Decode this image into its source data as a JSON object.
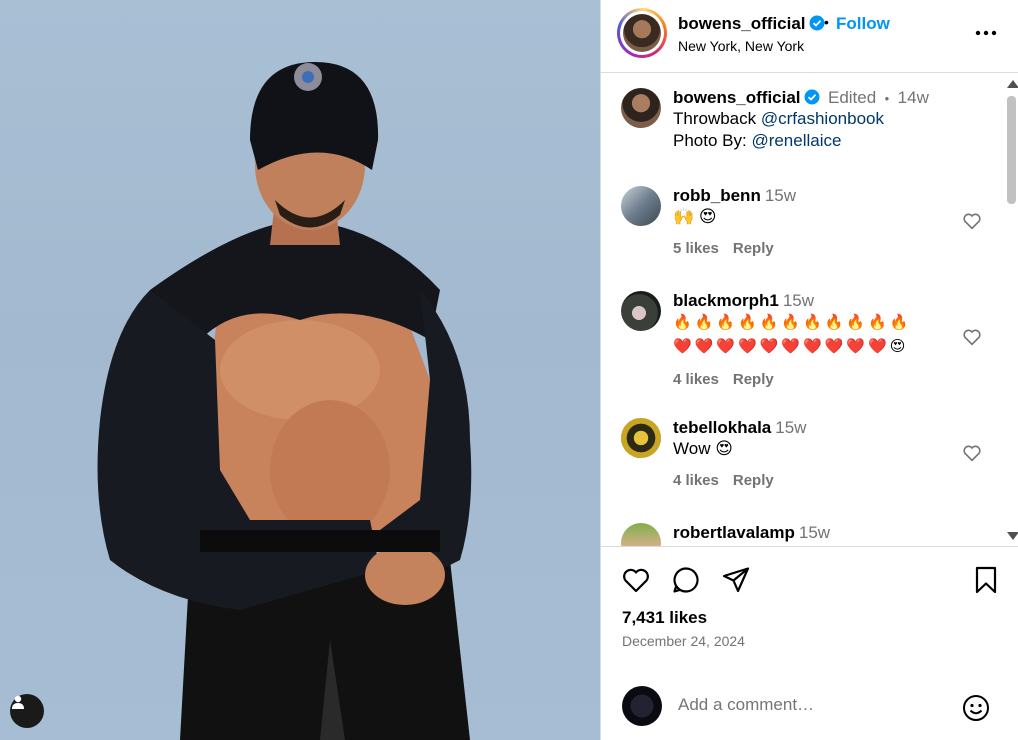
{
  "post": {
    "username": "bowens_official",
    "follow_label": "Follow",
    "separator": "•",
    "location": "New York, New York",
    "caption": {
      "username": "bowens_official",
      "edited_label": "Edited",
      "separator": "•",
      "time": "14w",
      "line1_prefix": "Throwback ",
      "line1_mention": "@crfashionbook",
      "line2_prefix": "Photo By: ",
      "line2_mention": "@renellaice"
    },
    "likes_text": "7,431 likes",
    "date": "December 24, 2024"
  },
  "comments": [
    {
      "username": "robb_benn",
      "time": "15w",
      "text": "🙌 😍",
      "likes": "5 likes",
      "reply": "Reply"
    },
    {
      "username": "blackmorph1",
      "time": "15w",
      "text_line1": "🔥🔥🔥🔥🔥🔥🔥🔥🔥🔥🔥",
      "text_line2": "❤️❤️❤️❤️❤️❤️❤️❤️❤️❤️😍",
      "likes": "4 likes",
      "reply": "Reply"
    },
    {
      "username": "tebellokhala",
      "time": "15w",
      "text": "Wow 😍",
      "likes": "4 likes",
      "reply": "Reply"
    },
    {
      "username": "robertlavalamp",
      "time": "15w"
    }
  ],
  "add_comment": {
    "placeholder": "Add a comment…"
  },
  "colors": {
    "accent": "#0095f6",
    "verified": "#0095f6",
    "muted": "#737373",
    "mention": "#00376b"
  },
  "icons": [
    "verified-badge-icon",
    "more-options-icon",
    "heart-icon",
    "comment-icon",
    "share-icon",
    "bookmark-icon",
    "emoji-icon",
    "user-tag-icon"
  ]
}
